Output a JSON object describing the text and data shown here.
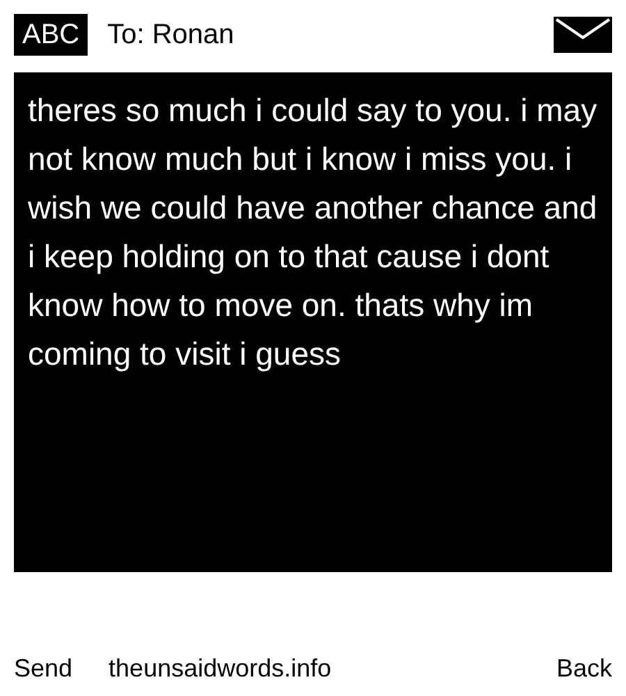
{
  "header": {
    "mode_badge": "ABC",
    "recipient": "To: Ronan"
  },
  "message": {
    "body": "theres so much i could say to you. i may not know much but i know i miss you. i wish we could have another chance and i keep holding on to that cause i dont know how to move on. thats why im coming to visit i guess"
  },
  "softkeys": {
    "left": "Send",
    "center": "theunsaidwords.info",
    "right": "Back"
  }
}
